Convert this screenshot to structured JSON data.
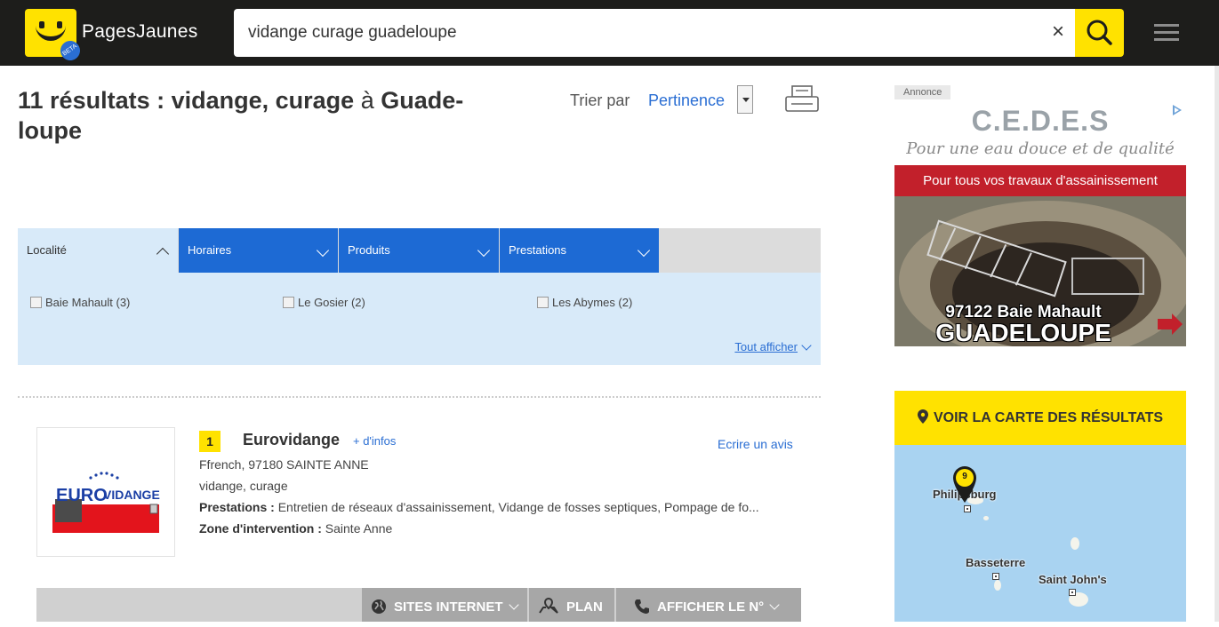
{
  "header": {
    "brand": "PagesJaunes",
    "beta_badge": "BETA",
    "search_value": "vidange curage guadeloupe",
    "clear_symbol": "×"
  },
  "results_title": {
    "count_text": "11 résultats : vidange, curage",
    "preposition": "à",
    "place": "Guade-loupe"
  },
  "sort": {
    "label": "Trier par",
    "value": "Pertinence"
  },
  "filters": {
    "tabs": [
      {
        "label": "Localité",
        "state": "expanded"
      },
      {
        "label": "Horaires",
        "state": "collapsed"
      },
      {
        "label": "Produits",
        "state": "collapsed"
      },
      {
        "label": "Prestations",
        "state": "collapsed"
      }
    ],
    "options": [
      "Baie Mahault (3)",
      "Le Gosier (2)",
      "Les Abymes (2)"
    ],
    "show_all": "Tout afficher"
  },
  "result": {
    "rank": "1",
    "name": "Eurovidange",
    "more_info": "+ d'infos",
    "review_link": "Ecrire un avis",
    "address": "Ffrench, 97180 SAINTE ANNE",
    "categories": "vidange, curage",
    "services_label": "Prestations :",
    "services_value": "Entretien de réseaux d'assainissement, Vidange de fosses septiques, Pompage de fo...",
    "zone_label": "Zone d'intervention :",
    "zone_value": "Sainte Anne",
    "logo_text_prefix": "EURO",
    "logo_text_suffix": "VIDANGE",
    "actions": [
      "SITES INTERNET",
      "PLAN",
      "AFFICHER LE N°"
    ]
  },
  "ad": {
    "label": "Annonce",
    "brand": "C.E.D.E.S",
    "tagline": "Pour une eau douce et de qualité",
    "banner": "Pour tous vos travaux d'assainissement",
    "location_line1": "97122 Baie Mahault",
    "location_line2": "GUADELOUPE"
  },
  "map": {
    "header": "VOIR LA CARTE DES RÉSULTATS",
    "marker_count": "9",
    "labels": [
      "Philipsburg",
      "Basseterre",
      "Saint John's"
    ]
  },
  "colors": {
    "brand_yellow": "#ffe200",
    "link_blue": "#2a6ed3",
    "tab_blue": "#1d6ad4",
    "ad_red": "#c2202b"
  }
}
